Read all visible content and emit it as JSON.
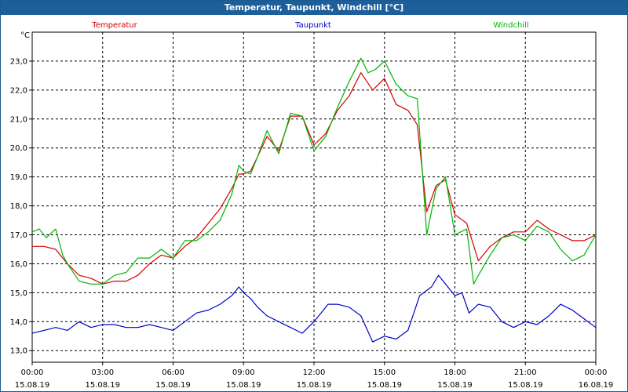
{
  "window": {
    "title": "Temperatur, Taupunkt, Windchill [°C]"
  },
  "chart_data": {
    "type": "line",
    "title": "Temperatur, Taupunkt, Windchill [°C]",
    "ylabel": "°C",
    "ylim": [
      12.6,
      24.0
    ],
    "yticks": [
      "13,0",
      "14,0",
      "15,0",
      "16,0",
      "17,0",
      "18,0",
      "19,0",
      "20,0",
      "21,0",
      "22,0",
      "23,0"
    ],
    "xlim": [
      0,
      24
    ],
    "xticks": [
      {
        "time": "00:00",
        "date": "15.08.19"
      },
      {
        "time": "03:00",
        "date": "15.08.19"
      },
      {
        "time": "06:00",
        "date": "15.08.19"
      },
      {
        "time": "09:00",
        "date": "15.08.19"
      },
      {
        "time": "12:00",
        "date": "15.08.19"
      },
      {
        "time": "15:00",
        "date": "15.08.19"
      },
      {
        "time": "18:00",
        "date": "15.08.19"
      },
      {
        "time": "21:00",
        "date": "15.08.19"
      },
      {
        "time": "00:00",
        "date": "16.08.19"
      }
    ],
    "grid": true,
    "series": [
      {
        "name": "Temperatur",
        "color": "#d40000",
        "x": [
          0,
          0.5,
          1,
          1.3,
          1.5,
          2,
          2.5,
          3,
          3.5,
          4,
          4.5,
          5,
          5.5,
          6,
          6.5,
          7,
          7.5,
          8,
          8.5,
          8.8,
          9,
          9.3,
          9.6,
          10,
          10.5,
          11,
          11.5,
          12,
          12.5,
          13,
          13.5,
          14,
          14.5,
          15,
          15.5,
          16,
          16.4,
          16.8,
          17.2,
          17.6,
          18,
          18.5,
          19,
          19.5,
          20,
          20.5,
          21,
          21.5,
          22,
          22.5,
          23,
          23.5,
          24
        ],
        "y": [
          16.6,
          16.6,
          16.5,
          16.2,
          16.0,
          15.6,
          15.5,
          15.3,
          15.4,
          15.4,
          15.6,
          16.0,
          16.3,
          16.2,
          16.6,
          16.9,
          17.4,
          17.9,
          18.6,
          19.1,
          19.1,
          19.2,
          19.7,
          20.4,
          19.9,
          21.1,
          21.1,
          20.1,
          20.5,
          21.3,
          21.8,
          22.6,
          22.0,
          22.4,
          21.5,
          21.3,
          20.8,
          17.8,
          18.7,
          18.9,
          17.7,
          17.4,
          16.1,
          16.6,
          16.9,
          17.1,
          17.1,
          17.5,
          17.2,
          17.0,
          16.8,
          16.8,
          17.0
        ]
      },
      {
        "name": "Taupunkt",
        "color": "#0000cc",
        "x": [
          0,
          0.5,
          1,
          1.5,
          2,
          2.5,
          3,
          3.5,
          4,
          4.5,
          5,
          5.5,
          6,
          6.5,
          7,
          7.5,
          8,
          8.5,
          8.8,
          9,
          9.3,
          9.6,
          10,
          10.5,
          11,
          11.5,
          12,
          12.3,
          12.6,
          13,
          13.5,
          14,
          14.5,
          15,
          15.5,
          16,
          16.5,
          17,
          17.3,
          17.6,
          18,
          18.3,
          18.6,
          19,
          19.5,
          20,
          20.5,
          21,
          21.5,
          22,
          22.5,
          23,
          23.5,
          24
        ],
        "y": [
          13.6,
          13.7,
          13.8,
          13.7,
          14.0,
          13.8,
          13.9,
          13.9,
          13.8,
          13.8,
          13.9,
          13.8,
          13.7,
          14.0,
          14.3,
          14.4,
          14.6,
          14.9,
          15.2,
          15.0,
          14.8,
          14.5,
          14.2,
          14.0,
          13.8,
          13.6,
          14.0,
          14.3,
          14.6,
          14.6,
          14.5,
          14.2,
          13.3,
          13.5,
          13.4,
          13.7,
          14.9,
          15.2,
          15.6,
          15.3,
          14.9,
          15.0,
          14.3,
          14.6,
          14.5,
          14.0,
          13.8,
          14.0,
          13.9,
          14.2,
          14.6,
          14.4,
          14.1,
          13.8
        ]
      },
      {
        "name": "Windchill",
        "color": "#00b400",
        "x": [
          0,
          0.3,
          0.6,
          1,
          1.3,
          1.5,
          2,
          2.5,
          3,
          3.5,
          4,
          4.5,
          5,
          5.5,
          6,
          6.5,
          7,
          7.5,
          8,
          8.5,
          8.8,
          9,
          9.3,
          9.6,
          10,
          10.5,
          11,
          11.5,
          12,
          12.5,
          13,
          13.5,
          14,
          14.3,
          14.6,
          15,
          15.5,
          16,
          16.4,
          16.8,
          17.2,
          17.6,
          18,
          18.5,
          18.8,
          19,
          19.5,
          20,
          20.5,
          21,
          21.5,
          22,
          22.5,
          23,
          23.5,
          24
        ],
        "y": [
          17.1,
          17.2,
          16.9,
          17.2,
          16.3,
          16.0,
          15.4,
          15.3,
          15.3,
          15.6,
          15.7,
          16.2,
          16.2,
          16.5,
          16.2,
          16.8,
          16.8,
          17.1,
          17.5,
          18.4,
          19.4,
          19.2,
          19.1,
          19.7,
          20.6,
          19.8,
          21.2,
          21.1,
          19.9,
          20.4,
          21.4,
          22.3,
          23.1,
          22.6,
          22.7,
          23.0,
          22.2,
          21.8,
          21.7,
          17.0,
          18.6,
          19.0,
          17.0,
          17.2,
          15.3,
          15.6,
          16.3,
          16.9,
          17.0,
          16.8,
          17.3,
          17.1,
          16.5,
          16.1,
          16.3,
          17.0
        ]
      }
    ]
  }
}
